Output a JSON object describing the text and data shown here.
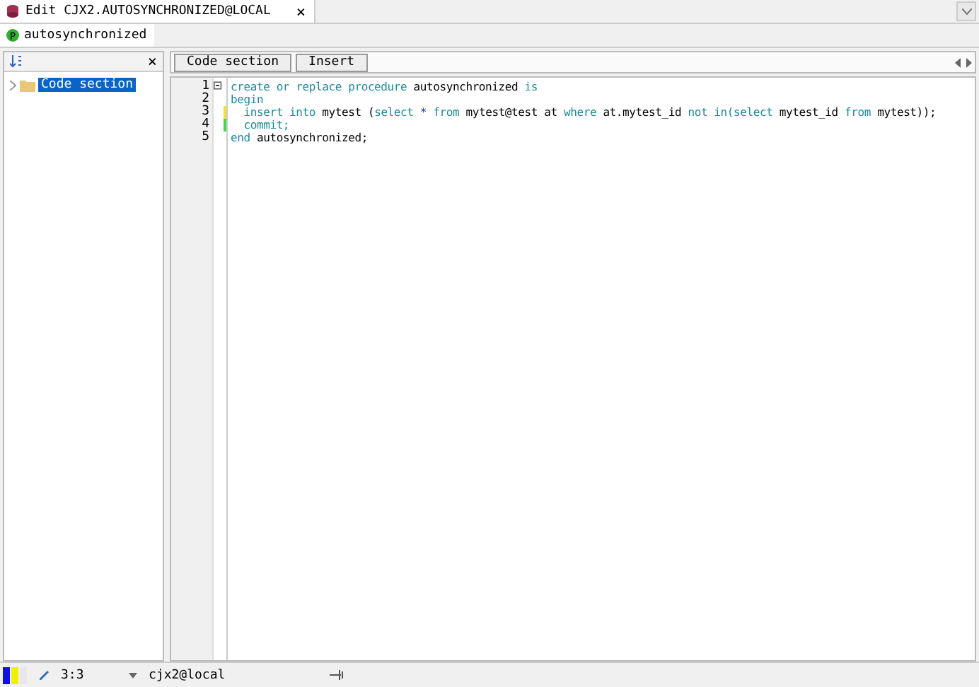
{
  "window": {
    "tab_title": "Edit CJX2.AUTOSYNCHRONIZED@LOCAL",
    "close": "×"
  },
  "object_tab": {
    "icon_letter": "P",
    "label": "autosynchronized"
  },
  "tree": {
    "close": "×",
    "items": [
      {
        "label": "Code section",
        "selected": true,
        "expanded": false
      }
    ]
  },
  "toolbar": {
    "buttons": [
      {
        "label": "Code section"
      },
      {
        "label": "Insert"
      }
    ]
  },
  "editor": {
    "lines": [
      {
        "number": "1",
        "modified": false,
        "saved": false,
        "tokens": [
          {
            "kind": "keyword",
            "text": "create or replace procedure"
          },
          {
            "kind": "plain",
            "text": " autosynchronized "
          },
          {
            "kind": "keyword",
            "text": "is"
          }
        ]
      },
      {
        "number": "2",
        "modified": false,
        "saved": false,
        "tokens": [
          {
            "kind": "keyword",
            "text": "begin"
          }
        ]
      },
      {
        "number": "3",
        "modified": true,
        "saved": false,
        "tokens": [
          {
            "kind": "keyword",
            "text": "  insert into"
          },
          {
            "kind": "plain",
            "text": " mytest ("
          },
          {
            "kind": "keyword",
            "text": "select"
          },
          {
            "kind": "operator",
            "text": " * "
          },
          {
            "kind": "keyword",
            "text": "from"
          },
          {
            "kind": "plain",
            "text": " mytest@test at "
          },
          {
            "kind": "keyword",
            "text": "where"
          },
          {
            "kind": "plain",
            "text": " at.mytest_id "
          },
          {
            "kind": "keyword",
            "text": "not in(select"
          },
          {
            "kind": "plain",
            "text": " mytest_id "
          },
          {
            "kind": "keyword",
            "text": "from"
          },
          {
            "kind": "plain",
            "text": " mytest));"
          }
        ]
      },
      {
        "number": "4",
        "modified": false,
        "saved": true,
        "tokens": [
          {
            "kind": "keyword",
            "text": "  commit;"
          }
        ]
      },
      {
        "number": "5",
        "modified": false,
        "saved": false,
        "tokens": [
          {
            "kind": "keyword",
            "text": "end"
          },
          {
            "kind": "plain",
            "text": " autosynchronized;"
          }
        ]
      }
    ]
  },
  "status_bar": {
    "position": "3:3",
    "connection": "cjx2@local"
  }
}
